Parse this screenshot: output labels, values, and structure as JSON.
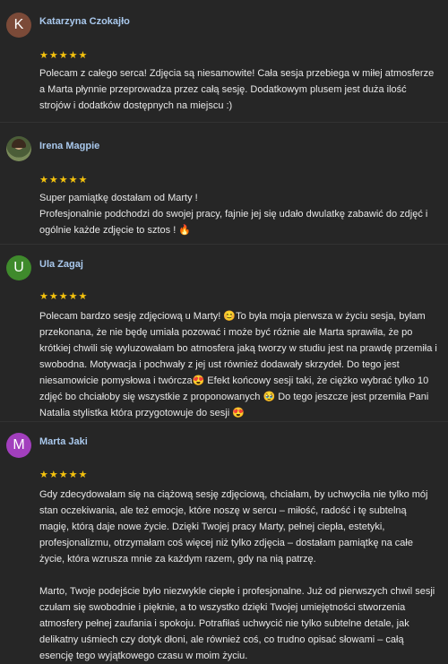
{
  "reviews": [
    {
      "author": "Katarzyna Czokajło",
      "avatar_letter": "K",
      "avatar_color": "#7b4a38",
      "rating": 5,
      "stars": "★★★★★",
      "text": "Polecam z całego serca! Zdjęcia są niesamowite! Cała sesja przebiega w miłej atmosferze a Marta płynnie przeprowadza przez całą sesję. Dodatkowym plusem jest duża ilość strojów i dodatków dostępnych na miejscu :)"
    },
    {
      "author": "Irena Magpie",
      "avatar_letter": "",
      "avatar_color": "#4b5d38",
      "rating": 5,
      "stars": "★★★★★",
      "text": "Super pamiątkę dostałam od Marty !\nProfesjonalnie podchodzi do swojej pracy, fajnie jej się udało dwulatkę zabawić do zdjęć i ogólnie każde zdjęcie to sztos ! 🔥"
    },
    {
      "author": "Ula Zagaj",
      "avatar_letter": "U",
      "avatar_color": "#3f8a2c",
      "rating": 5,
      "stars": "★★★★★",
      "text": "Polecam bardzo sesję zdjęciową u Marty! 😊To była moja pierwsza w życiu sesja, byłam przekonana, że nie będę umiała pozować i może być różnie ale Marta sprawiła, że po krótkiej chwili się wyluzowałam bo atmosfera jaką tworzy w studiu jest na prawdę przemiła i swobodna. Motywacja i pochwały z jej ust również dodawały skrzydeł. Do tego jest niesamowicie pomysłowa i twórcza😍 Efekt końcowy sesji taki, że ciężko wybrać tylko 10 zdjęć bo chciałoby się wszystkie z proponowanych 🥹 Do tego jeszcze jest przemiła Pani Natalia stylistka która przygotowuje do sesji 😍"
    },
    {
      "author": "Marta Jaki",
      "avatar_letter": "M",
      "avatar_color": "#a23fbd",
      "rating": 5,
      "stars": "★★★★★",
      "text": "Gdy zdecydowałam się na ciążową sesję zdjęciową, chciałam, by uchwyciła nie tylko mój stan oczekiwania, ale też emocje, które noszę w sercu – miłość, radość i tę subtelną magię, którą daje nowe życie. Dzięki Twojej pracy Marty, pełnej ciepła, estetyki, profesjonalizmu, otrzymałam coś więcej niż tylko zdjęcia – dostałam pamiątkę na całe życie, która wzrusza mnie za każdym razem, gdy na nią patrzę.\n\nMarto, Twoje podejście było niezwykle ciepłe i profesjonalne. Już od pierwszych chwil sesji czułam się swobodnie i pięknie, a to wszystko dzięki Twojej umiejętności stworzenia atmosfery pełnej zaufania i spokoju. Potrafiłaś uchwycić nie tylko subtelne detale, jak delikatny uśmiech czy dotyk dłoni, ale również coś, co trudno opisać słowami – całą esencję tego wyjątkowego czasu w moim życiu."
    }
  ]
}
